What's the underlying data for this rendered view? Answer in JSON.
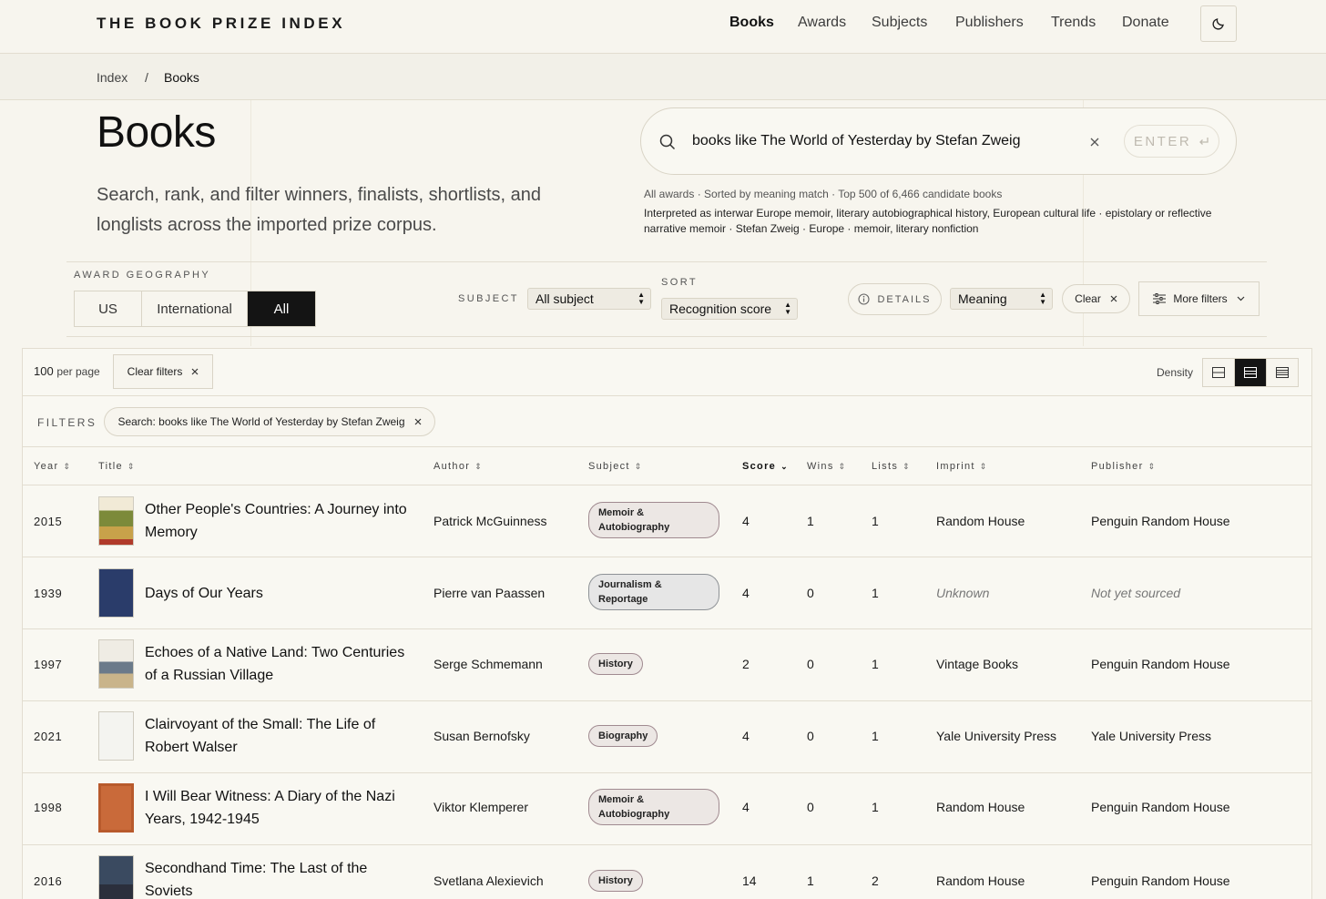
{
  "brand": "THE BOOK PRIZE INDEX",
  "nav": [
    "Books",
    "Awards",
    "Subjects",
    "Publishers",
    "Trends",
    "Donate"
  ],
  "breadcrumb": [
    "Index",
    "/",
    "Books"
  ],
  "page": {
    "title": "Books",
    "lede": "Search, rank, and filter winners, finalists, shortlists, and longlists across the imported prize corpus."
  },
  "search": {
    "query": "books like The World of Yesterday by Stefan Zweig",
    "enter_label": "ENTER",
    "meta": "All awards · Sorted by meaning match · Top 500 of 6,466 candidate books",
    "interpretation": "Interpreted as interwar Europe memoir, literary autobiographical history, European cultural life · epistolary or reflective narrative memoir · Stefan Zweig · Europe · memoir, literary nonfiction"
  },
  "filters": {
    "geography_label": "AWARD GEOGRAPHY",
    "geography_options": [
      "US",
      "International",
      "All"
    ],
    "subject_label": "SUBJECT",
    "subject_value": "All subject",
    "sort_label": "SORT",
    "sort_value": "Recognition score",
    "details_label": "DETAILS",
    "meaning_value": "Meaning",
    "clear_label": "Clear",
    "more_label": "More filters"
  },
  "toolbar": {
    "per_page_num": "100",
    "per_page_text": "per page",
    "clear_filters": "Clear filters",
    "density_label": "Density"
  },
  "chips": {
    "label": "FILTERS",
    "items": [
      "Search: books like The World of Yesterday by Stefan Zweig"
    ]
  },
  "table": {
    "columns": [
      "Year",
      "Title",
      "Author",
      "Subject",
      "Score",
      "Wins",
      "Lists",
      "Imprint",
      "Publisher"
    ],
    "rows": [
      {
        "year": "2015",
        "title": "Other People's Countries: A Journey into Memory",
        "author": "Patrick McGuinness",
        "subject": "Memoir & Autobiography",
        "score": "4",
        "wins": "1",
        "lists": "1",
        "imprint": "Random House",
        "publisher": "Penguin Random House"
      },
      {
        "year": "1939",
        "title": "Days of Our Years",
        "author": "Pierre van Paassen",
        "subject": "Journalism & Reportage",
        "score": "4",
        "wins": "0",
        "lists": "1",
        "imprint": "Unknown",
        "publisher": "Not yet sourced"
      },
      {
        "year": "1997",
        "title": "Echoes of a Native Land: Two Centuries of a Russian Village",
        "author": "Serge Schmemann",
        "subject": "History",
        "score": "2",
        "wins": "0",
        "lists": "1",
        "imprint": "Vintage Books",
        "publisher": "Penguin Random House"
      },
      {
        "year": "2021",
        "title": "Clairvoyant of the Small: The Life of Robert Walser",
        "author": "Susan Bernofsky",
        "subject": "Biography",
        "score": "4",
        "wins": "0",
        "lists": "1",
        "imprint": "Yale University Press",
        "publisher": "Yale University Press"
      },
      {
        "year": "1998",
        "title": "I Will Bear Witness: A Diary of the Nazi Years, 1942-1945",
        "author": "Viktor Klemperer",
        "subject": "Memoir & Autobiography",
        "score": "4",
        "wins": "0",
        "lists": "1",
        "imprint": "Random House",
        "publisher": "Penguin Random House"
      },
      {
        "year": "2016",
        "title": "Secondhand Time: The Last of the Soviets",
        "author": "Svetlana Alexievich",
        "subject": "History",
        "score": "14",
        "wins": "1",
        "lists": "2",
        "imprint": "Random House",
        "publisher": "Penguin Random House"
      }
    ]
  },
  "colors": {
    "background": "#f7f5ee",
    "accent_dark": "#141414",
    "badge_fill": "#ece7e4",
    "badge_border": "#a08a90"
  }
}
